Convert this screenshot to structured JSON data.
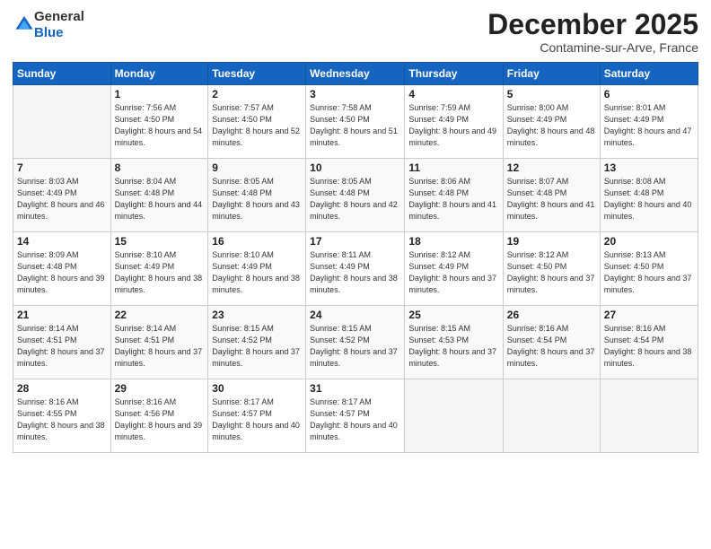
{
  "logo": {
    "general": "General",
    "blue": "Blue"
  },
  "header": {
    "month": "December 2025",
    "location": "Contamine-sur-Arve, France"
  },
  "weekdays": [
    "Sunday",
    "Monday",
    "Tuesday",
    "Wednesday",
    "Thursday",
    "Friday",
    "Saturday"
  ],
  "weeks": [
    [
      {
        "day": "",
        "empty": true
      },
      {
        "day": "1",
        "sunrise": "7:56 AM",
        "sunset": "4:50 PM",
        "daylight": "8 hours and 54 minutes."
      },
      {
        "day": "2",
        "sunrise": "7:57 AM",
        "sunset": "4:50 PM",
        "daylight": "8 hours and 52 minutes."
      },
      {
        "day": "3",
        "sunrise": "7:58 AM",
        "sunset": "4:50 PM",
        "daylight": "8 hours and 51 minutes."
      },
      {
        "day": "4",
        "sunrise": "7:59 AM",
        "sunset": "4:49 PM",
        "daylight": "8 hours and 49 minutes."
      },
      {
        "day": "5",
        "sunrise": "8:00 AM",
        "sunset": "4:49 PM",
        "daylight": "8 hours and 48 minutes."
      },
      {
        "day": "6",
        "sunrise": "8:01 AM",
        "sunset": "4:49 PM",
        "daylight": "8 hours and 47 minutes."
      }
    ],
    [
      {
        "day": "7",
        "sunrise": "8:03 AM",
        "sunset": "4:49 PM",
        "daylight": "8 hours and 46 minutes."
      },
      {
        "day": "8",
        "sunrise": "8:04 AM",
        "sunset": "4:48 PM",
        "daylight": "8 hours and 44 minutes."
      },
      {
        "day": "9",
        "sunrise": "8:05 AM",
        "sunset": "4:48 PM",
        "daylight": "8 hours and 43 minutes."
      },
      {
        "day": "10",
        "sunrise": "8:05 AM",
        "sunset": "4:48 PM",
        "daylight": "8 hours and 42 minutes."
      },
      {
        "day": "11",
        "sunrise": "8:06 AM",
        "sunset": "4:48 PM",
        "daylight": "8 hours and 41 minutes."
      },
      {
        "day": "12",
        "sunrise": "8:07 AM",
        "sunset": "4:48 PM",
        "daylight": "8 hours and 41 minutes."
      },
      {
        "day": "13",
        "sunrise": "8:08 AM",
        "sunset": "4:48 PM",
        "daylight": "8 hours and 40 minutes."
      }
    ],
    [
      {
        "day": "14",
        "sunrise": "8:09 AM",
        "sunset": "4:48 PM",
        "daylight": "8 hours and 39 minutes."
      },
      {
        "day": "15",
        "sunrise": "8:10 AM",
        "sunset": "4:49 PM",
        "daylight": "8 hours and 38 minutes."
      },
      {
        "day": "16",
        "sunrise": "8:10 AM",
        "sunset": "4:49 PM",
        "daylight": "8 hours and 38 minutes."
      },
      {
        "day": "17",
        "sunrise": "8:11 AM",
        "sunset": "4:49 PM",
        "daylight": "8 hours and 38 minutes."
      },
      {
        "day": "18",
        "sunrise": "8:12 AM",
        "sunset": "4:49 PM",
        "daylight": "8 hours and 37 minutes."
      },
      {
        "day": "19",
        "sunrise": "8:12 AM",
        "sunset": "4:50 PM",
        "daylight": "8 hours and 37 minutes."
      },
      {
        "day": "20",
        "sunrise": "8:13 AM",
        "sunset": "4:50 PM",
        "daylight": "8 hours and 37 minutes."
      }
    ],
    [
      {
        "day": "21",
        "sunrise": "8:14 AM",
        "sunset": "4:51 PM",
        "daylight": "8 hours and 37 minutes."
      },
      {
        "day": "22",
        "sunrise": "8:14 AM",
        "sunset": "4:51 PM",
        "daylight": "8 hours and 37 minutes."
      },
      {
        "day": "23",
        "sunrise": "8:15 AM",
        "sunset": "4:52 PM",
        "daylight": "8 hours and 37 minutes."
      },
      {
        "day": "24",
        "sunrise": "8:15 AM",
        "sunset": "4:52 PM",
        "daylight": "8 hours and 37 minutes."
      },
      {
        "day": "25",
        "sunrise": "8:15 AM",
        "sunset": "4:53 PM",
        "daylight": "8 hours and 37 minutes."
      },
      {
        "day": "26",
        "sunrise": "8:16 AM",
        "sunset": "4:54 PM",
        "daylight": "8 hours and 37 minutes."
      },
      {
        "day": "27",
        "sunrise": "8:16 AM",
        "sunset": "4:54 PM",
        "daylight": "8 hours and 38 minutes."
      }
    ],
    [
      {
        "day": "28",
        "sunrise": "8:16 AM",
        "sunset": "4:55 PM",
        "daylight": "8 hours and 38 minutes."
      },
      {
        "day": "29",
        "sunrise": "8:16 AM",
        "sunset": "4:56 PM",
        "daylight": "8 hours and 39 minutes."
      },
      {
        "day": "30",
        "sunrise": "8:17 AM",
        "sunset": "4:57 PM",
        "daylight": "8 hours and 40 minutes."
      },
      {
        "day": "31",
        "sunrise": "8:17 AM",
        "sunset": "4:57 PM",
        "daylight": "8 hours and 40 minutes."
      },
      {
        "day": "",
        "empty": true
      },
      {
        "day": "",
        "empty": true
      },
      {
        "day": "",
        "empty": true
      }
    ]
  ]
}
